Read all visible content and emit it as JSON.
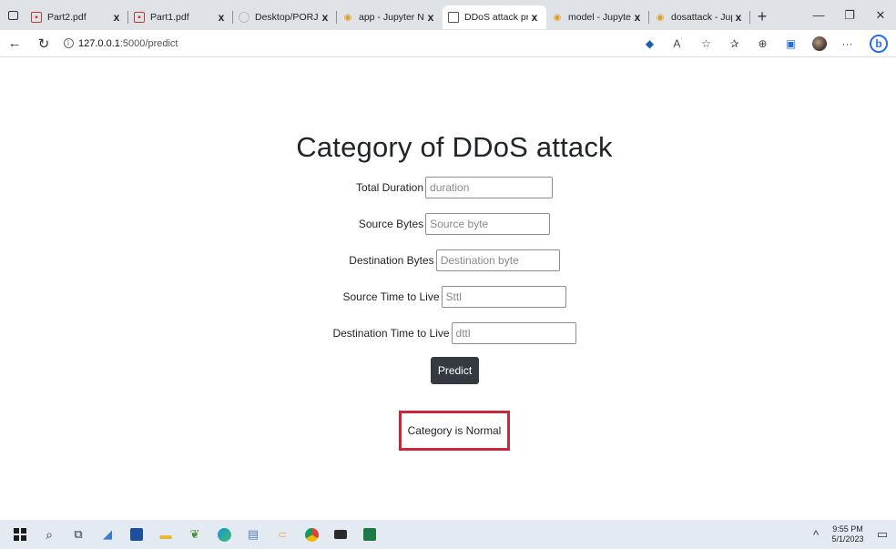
{
  "browser": {
    "tabs": [
      {
        "title": "Part2.pdf",
        "icon": "pdf-icon"
      },
      {
        "title": "Part1.pdf",
        "icon": "pdf-icon"
      },
      {
        "title": "Desktop/PORJEC",
        "icon": "loading-icon"
      },
      {
        "title": "app - Jupyter No",
        "icon": "jupyter-icon"
      },
      {
        "title": "DDoS attack pred",
        "icon": "document-icon",
        "active": true
      },
      {
        "title": "model - Jupyter N",
        "icon": "jupyter-icon"
      },
      {
        "title": "dosattack - Jupyt",
        "icon": "jupyter-icon"
      }
    ],
    "close_glyph": "x",
    "address": {
      "host": "127.0.0.1",
      "path": ":5000/predict"
    }
  },
  "page": {
    "title": "Category of DDoS attack",
    "fields": [
      {
        "label": "Total Duration",
        "placeholder": "duration"
      },
      {
        "label": "Source Bytes",
        "placeholder": "Source byte"
      },
      {
        "label": "Destination Bytes",
        "placeholder": "Destination byte"
      },
      {
        "label": "Source Time to Live",
        "placeholder": "Sttl"
      },
      {
        "label": "Destination Time to Live",
        "placeholder": "dttl"
      }
    ],
    "predict_label": "Predict",
    "result_text": "Category is Normal",
    "result_border_color": "#c8283a"
  },
  "taskbar": {
    "time": "9:55 PM",
    "date": "5/1/2023",
    "apps": [
      "start-icon",
      "search-icon",
      "task-view-icon",
      "files-icon",
      "store-icon",
      "file-explorer-icon",
      "app-icon",
      "edge-icon",
      "notepad-icon",
      "jupyter-icon",
      "chrome-icon",
      "terminal-icon",
      "excel-icon"
    ]
  }
}
